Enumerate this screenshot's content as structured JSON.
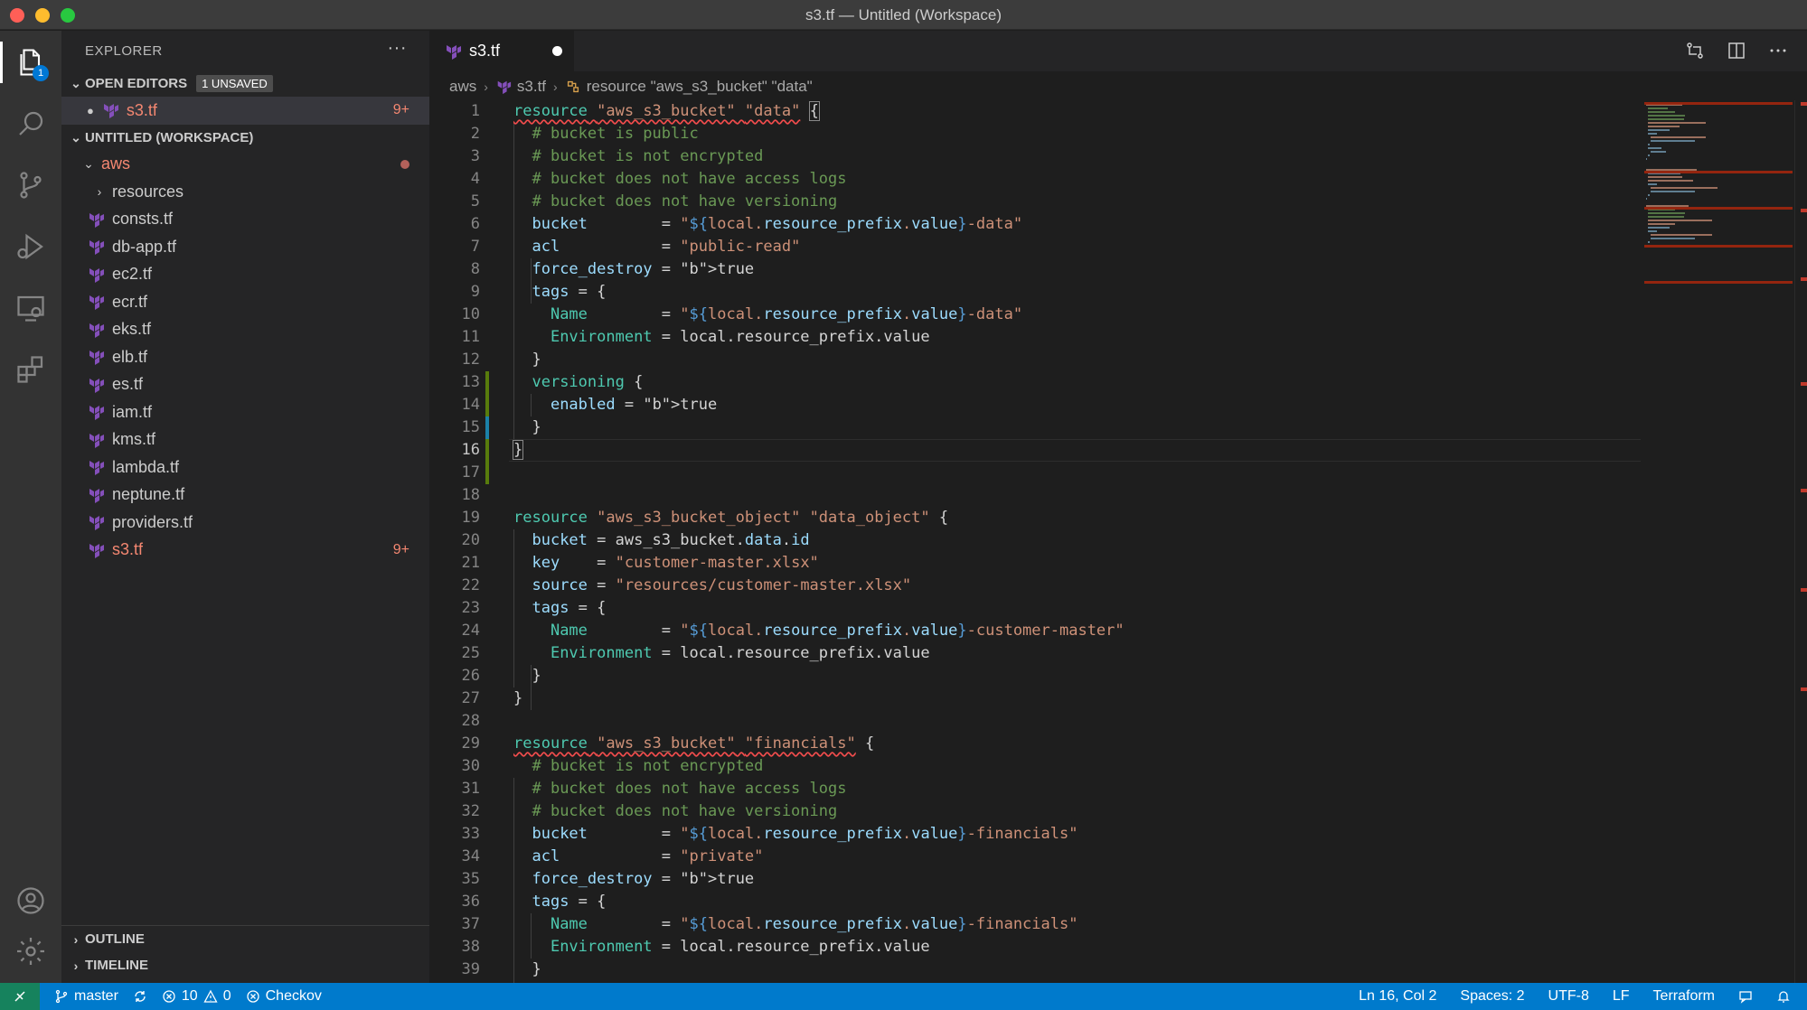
{
  "window": {
    "title": "s3.tf — Untitled (Workspace)"
  },
  "activity_bar": {
    "explorer_badge": "1"
  },
  "sidebar": {
    "title": "EXPLORER",
    "more": "···",
    "open_editors": {
      "label": "OPEN EDITORS",
      "badge": "1 UNSAVED",
      "file": "s3.tf",
      "count": "9+"
    },
    "workspace": {
      "label": "UNTITLED (WORKSPACE)",
      "folder": "aws",
      "subfolder": "resources",
      "files": [
        "consts.tf",
        "db-app.tf",
        "ec2.tf",
        "ecr.tf",
        "eks.tf",
        "elb.tf",
        "es.tf",
        "iam.tf",
        "kms.tf",
        "lambda.tf",
        "neptune.tf",
        "providers.tf"
      ],
      "error_file": "s3.tf",
      "error_count": "9+"
    },
    "outline": "OUTLINE",
    "timeline": "TIMELINE"
  },
  "tab": {
    "label": "s3.tf"
  },
  "breadcrumb": {
    "folder": "aws",
    "file": "s3.tf",
    "symbol": "resource \"aws_s3_bucket\" \"data\""
  },
  "editor": {
    "current_line": 16,
    "lines": [
      "resource \"aws_s3_bucket\" \"data\" {",
      "  # bucket is public",
      "  # bucket is not encrypted",
      "  # bucket does not have access logs",
      "  # bucket does not have versioning",
      "  bucket        = \"${local.resource_prefix.value}-data\"",
      "  acl           = \"public-read\"",
      "  force_destroy = true",
      "  tags = {",
      "    Name        = \"${local.resource_prefix.value}-data\"",
      "    Environment = local.resource_prefix.value",
      "  }",
      "  versioning {",
      "    enabled = true",
      "  }",
      "}",
      "",
      "",
      "resource \"aws_s3_bucket_object\" \"data_object\" {",
      "  bucket = aws_s3_bucket.data.id",
      "  key    = \"customer-master.xlsx\"",
      "  source = \"resources/customer-master.xlsx\"",
      "  tags = {",
      "    Name        = \"${local.resource_prefix.value}-customer-master\"",
      "    Environment = local.resource_prefix.value",
      "  }",
      "}",
      "",
      "resource \"aws_s3_bucket\" \"financials\" {",
      "  # bucket is not encrypted",
      "  # bucket does not have access logs",
      "  # bucket does not have versioning",
      "  bucket        = \"${local.resource_prefix.value}-financials\"",
      "  acl           = \"private\"",
      "  force_destroy = true",
      "  tags = {",
      "    Name        = \"${local.resource_prefix.value}-financials\"",
      "    Environment = local.resource_prefix.value",
      "  }"
    ]
  },
  "status_bar": {
    "branch": "master",
    "errors": "10",
    "warnings": "0",
    "checkov": "Checkov",
    "position": "Ln 16, Col 2",
    "spaces": "Spaces: 2",
    "encoding": "UTF-8",
    "eol": "LF",
    "language": "Terraform"
  },
  "colors": {
    "accent": "#007acc",
    "error": "#f48771",
    "keyword": "#4ec9b0",
    "string": "#ce9178",
    "comment": "#6a9955"
  }
}
